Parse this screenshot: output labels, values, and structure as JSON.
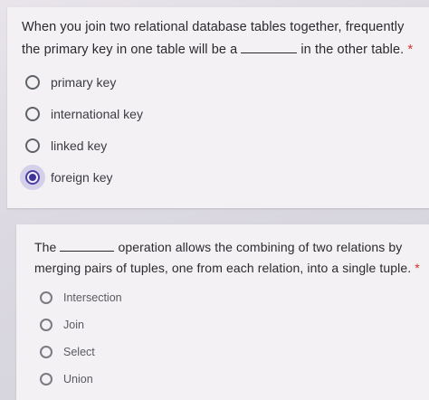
{
  "q1": {
    "text_before": "When you join two relational database tables together, frequently the primary key in one table will be a",
    "text_after": "in the other table.",
    "required_mark": "*",
    "options": [
      {
        "label": "primary key",
        "selected": false
      },
      {
        "label": "international key",
        "selected": false
      },
      {
        "label": "linked key",
        "selected": false
      },
      {
        "label": "foreign key",
        "selected": true
      }
    ]
  },
  "q2": {
    "text_before": "The",
    "text_after": "operation allows the combining of two relations by merging pairs of tuples, one from each relation, into a single tuple.",
    "required_mark": "*",
    "options": [
      {
        "label": "Intersection",
        "selected": false
      },
      {
        "label": "Join",
        "selected": false
      },
      {
        "label": "Select",
        "selected": false
      },
      {
        "label": "Union",
        "selected": false
      }
    ]
  },
  "colors": {
    "accent": "#3f3397",
    "required": "#d93025"
  }
}
